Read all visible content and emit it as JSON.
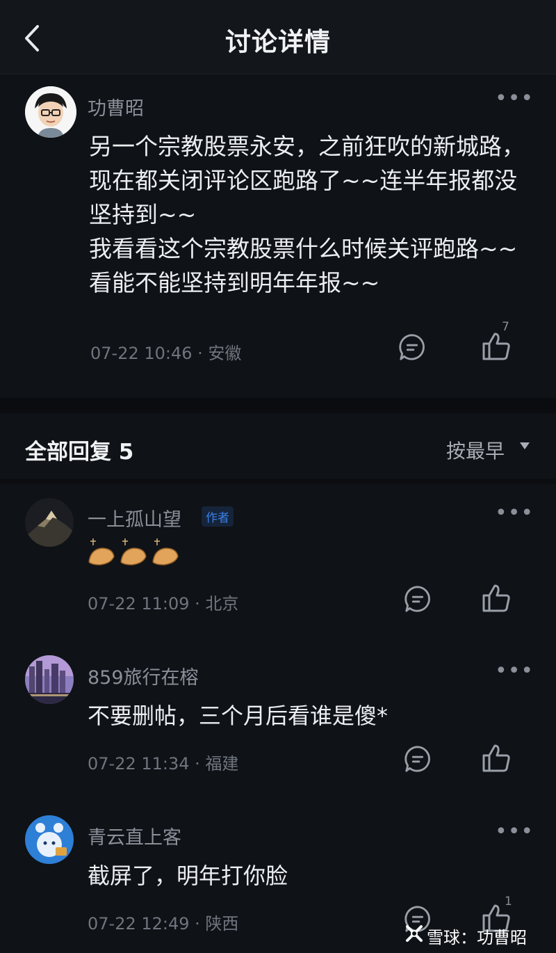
{
  "header": {
    "title": "讨论详情"
  },
  "post": {
    "author": "功曹昭",
    "lines": [
      "另一个宗教股票永安，之前狂吹的新城路，现在都关闭评论区跑路了~~连半年报都没坚持到~~",
      "我看看这个宗教股票什么时候关评跑路~~看能不能坚持到明年年报~~"
    ],
    "meta": "07-22 10:46 · 安徽",
    "like_count": "7"
  },
  "replies_header": {
    "title": "全部回复 5",
    "sort_label": "按最早"
  },
  "replies": [
    {
      "author": "一上孤山望",
      "badge": "作者",
      "text": "",
      "meta": "07-22 11:09 · 北京",
      "like_count": ""
    },
    {
      "author": "859旅行在榕",
      "badge": "",
      "text": "不要删帖，三个月后看谁是傻*",
      "meta": "07-22 11:34 · 福建",
      "like_count": ""
    },
    {
      "author": "青云直上客",
      "badge": "",
      "text": "截屏了，明年打你脸",
      "meta": "07-22 12:49 · 陕西",
      "like_count": "1"
    }
  ],
  "watermark": {
    "text": "雪球：功曹昭"
  },
  "icons": {
    "back": "chevron-left-icon",
    "more": "more-dots-icon",
    "comment": "comment-bubble-icon",
    "like": "thumbs-up-icon",
    "sort_caret": "caret-down-icon",
    "emoji": "clapping-hands-emoji"
  },
  "colors": {
    "background": "#0f1216",
    "accent": "#3b7fe6",
    "text": "#eceef1",
    "muted": "#6f757f"
  }
}
